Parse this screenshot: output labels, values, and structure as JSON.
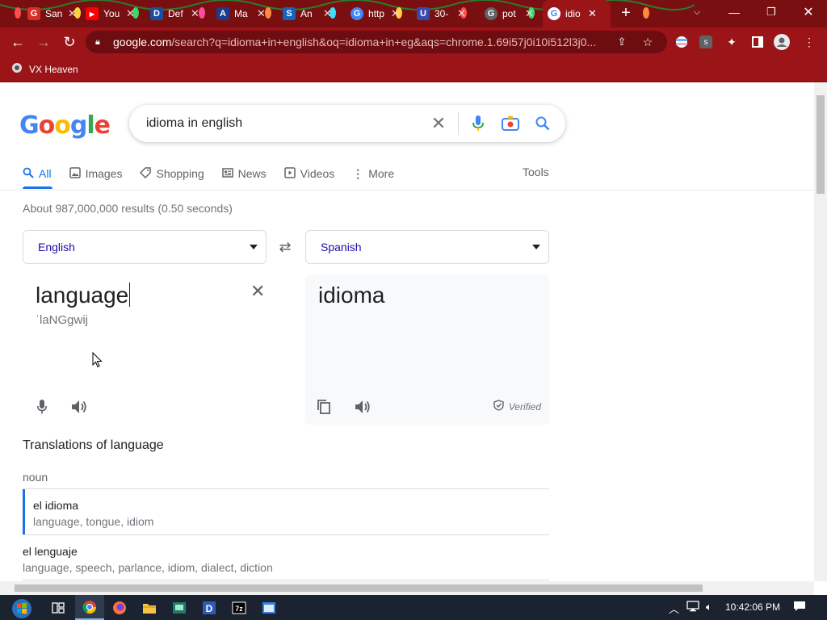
{
  "browser": {
    "tabs": [
      {
        "title": "San",
        "favicon_color": "#d93025",
        "favicon_icon": "G"
      },
      {
        "title": "You",
        "favicon_color": "#ff0000",
        "favicon_icon": "▶"
      },
      {
        "title": "Def",
        "favicon_color": "#1a4fa0",
        "favicon_icon": "D"
      },
      {
        "title": "Ma",
        "favicon_color": "#1e3a8a",
        "favicon_icon": "A"
      },
      {
        "title": "An",
        "favicon_color": "#1565c0",
        "favicon_icon": "S"
      },
      {
        "title": "http",
        "favicon_color": "#4285f4",
        "favicon_icon": "G"
      },
      {
        "title": "30-",
        "favicon_color": "#3949ab",
        "favicon_icon": "U"
      },
      {
        "title": "pot",
        "favicon_color": "#5f6368",
        "favicon_icon": "G"
      },
      {
        "title": "idio",
        "favicon_color": "#4285f4",
        "favicon_icon": "G",
        "active": true
      }
    ],
    "address": {
      "domain": "google.com",
      "path": "/search?q=idioma+in+english&oq=idioma+in+eg&aqs=chrome.1.69i57j0i10i512l3j0..."
    },
    "bookmark": "VX Heaven",
    "accent_color": "#9b1418"
  },
  "google": {
    "logo_letters": [
      "G",
      "o",
      "o",
      "g",
      "l",
      "e"
    ],
    "query": "idioma in english",
    "nav_tabs": [
      {
        "label": "All",
        "icon": "search-icon",
        "active": true
      },
      {
        "label": "Images",
        "icon": "image-icon"
      },
      {
        "label": "Shopping",
        "icon": "tag-icon"
      },
      {
        "label": "News",
        "icon": "news-icon"
      },
      {
        "label": "Videos",
        "icon": "play-icon"
      },
      {
        "label": "More",
        "icon": "more-vert-icon"
      }
    ],
    "tools": "Tools",
    "stats": "About 987,000,000 results (0.50 seconds)"
  },
  "translate": {
    "source_lang": "English",
    "target_lang": "Spanish",
    "source_text": "language",
    "phonetic": "ˈlaNGgwij",
    "target_text": "idioma",
    "verified": "Verified",
    "translations_title": "Translations of language",
    "pos": "noun",
    "rows": [
      {
        "word": "el idioma",
        "synonyms": "language, tongue, idiom",
        "selected": true
      },
      {
        "word": "el lenguaje",
        "synonyms": "language, speech, parlance, idiom, dialect, diction"
      }
    ]
  },
  "taskbar": {
    "clock": "10:42:06 PM",
    "icons": [
      "task-view-icon",
      "chrome-icon",
      "firefox-icon",
      "file-explorer-icon",
      "app-icon",
      "dev-icon",
      "7zip-icon",
      "window-icon"
    ]
  }
}
